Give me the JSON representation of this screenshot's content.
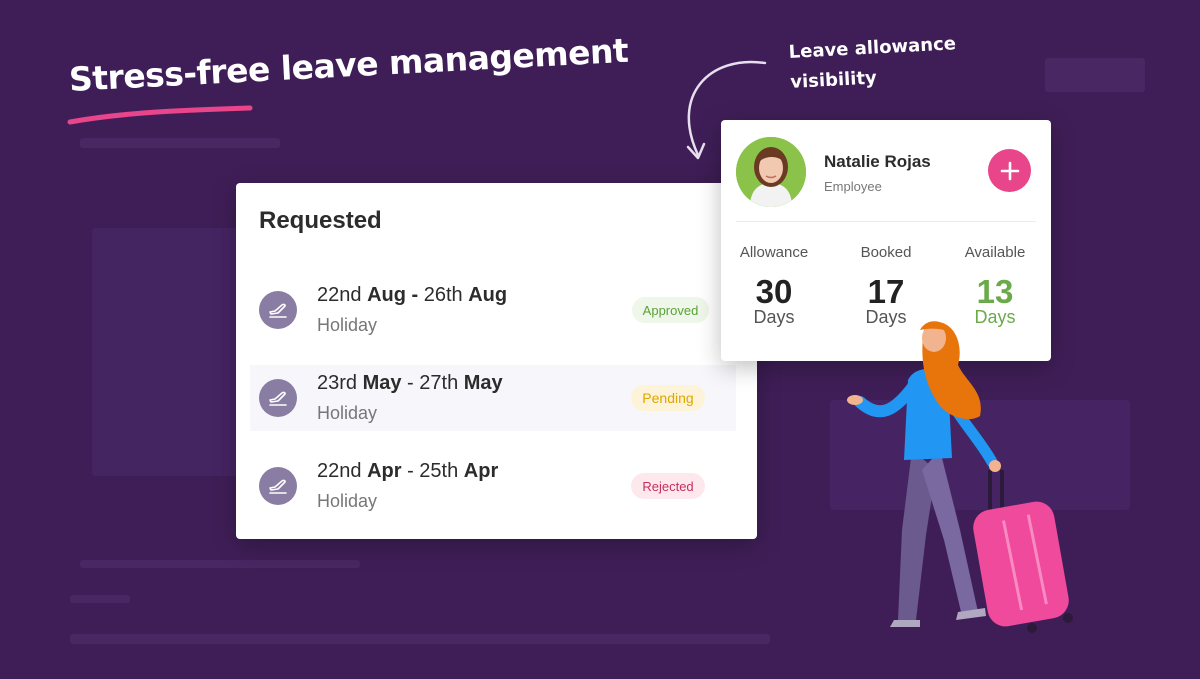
{
  "headline": "Stress-free leave management",
  "annotation": {
    "line1": "Leave allowance",
    "line2": "visibility"
  },
  "requested": {
    "title": "Requested",
    "items": [
      {
        "start_day": "22nd ",
        "start_month": "Aug",
        "separator": " - ",
        "end_day": "26th ",
        "end_month": "Aug",
        "type": "Holiday",
        "status": "Approved",
        "highlighted": false
      },
      {
        "start_day": "23rd ",
        "start_month": "May",
        "separator": " - ",
        "end_day": "27th ",
        "end_month": "May",
        "type": "Holiday",
        "status": "Pending",
        "highlighted": true
      },
      {
        "start_day": "22nd ",
        "start_month": "Apr",
        "separator": " - ",
        "end_day": "25th ",
        "end_month": "Apr",
        "type": "Holiday",
        "status": "Rejected",
        "highlighted": false
      }
    ]
  },
  "employee": {
    "name": "Natalie Rojas",
    "role": "Employee",
    "stats": [
      {
        "label": "Allowance",
        "value": "30",
        "unit": "Days"
      },
      {
        "label": "Booked",
        "value": "17",
        "unit": "Days"
      },
      {
        "label": "Available",
        "value": "13",
        "unit": "Days"
      }
    ]
  },
  "colors": {
    "background": "#3f1e57",
    "accent_pink": "#e8458a",
    "available_green": "#6aaa4b",
    "icon_purple": "#8a7da3"
  },
  "icons": {
    "leave": "airplane-takeoff-icon",
    "add": "plus-icon"
  }
}
